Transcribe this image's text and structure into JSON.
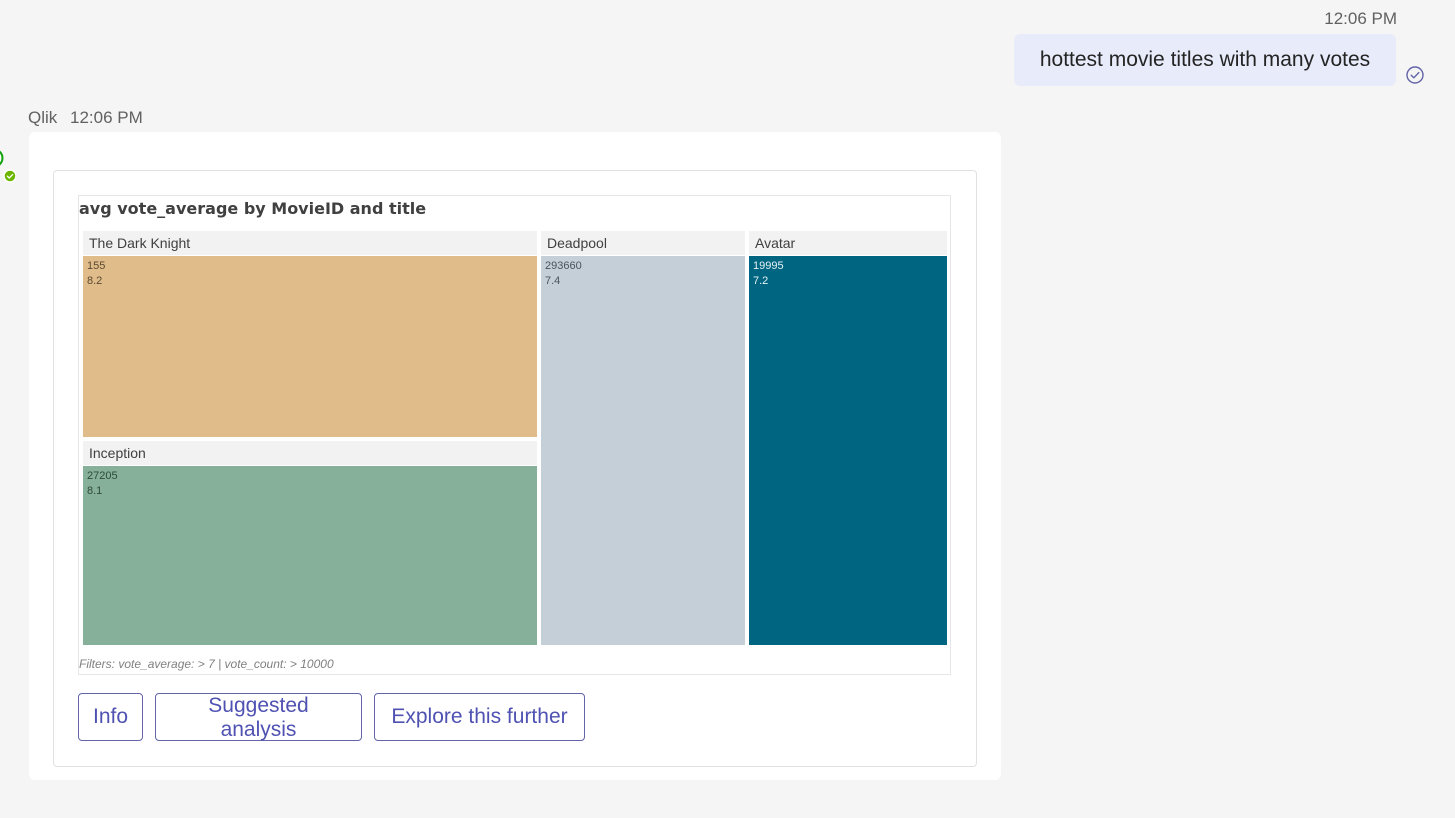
{
  "user_message": {
    "time": "12:06 PM",
    "text": "hottest movie titles with many votes",
    "status_icon": "read-receipt-check-icon"
  },
  "bot_message": {
    "sender": "Qlik",
    "time": "12:06 PM"
  },
  "chart_data": {
    "type": "treemap",
    "title": "avg vote_average by MovieID and title",
    "groups": [
      {
        "title": "The Dark Knight",
        "movie_id": "155",
        "value": "8.2",
        "color": "#e0bc8b"
      },
      {
        "title": "Inception",
        "movie_id": "27205",
        "value": "8.1",
        "color": "#86b09a"
      },
      {
        "title": "Deadpool",
        "movie_id": "293660",
        "value": "7.4",
        "color": "#c5cfd8"
      },
      {
        "title": "Avatar",
        "movie_id": "19995",
        "value": "7.2",
        "color": "#006580"
      }
    ],
    "filters": "Filters: vote_average: > 7 | vote_count: > 10000"
  },
  "actions": {
    "info": "Info",
    "suggested": "Suggested analysis",
    "explore": "Explore this further"
  },
  "colors": {
    "accent": "#6264a7",
    "user_bubble": "#e8ebfa",
    "avatar_status": "#6bb700"
  }
}
